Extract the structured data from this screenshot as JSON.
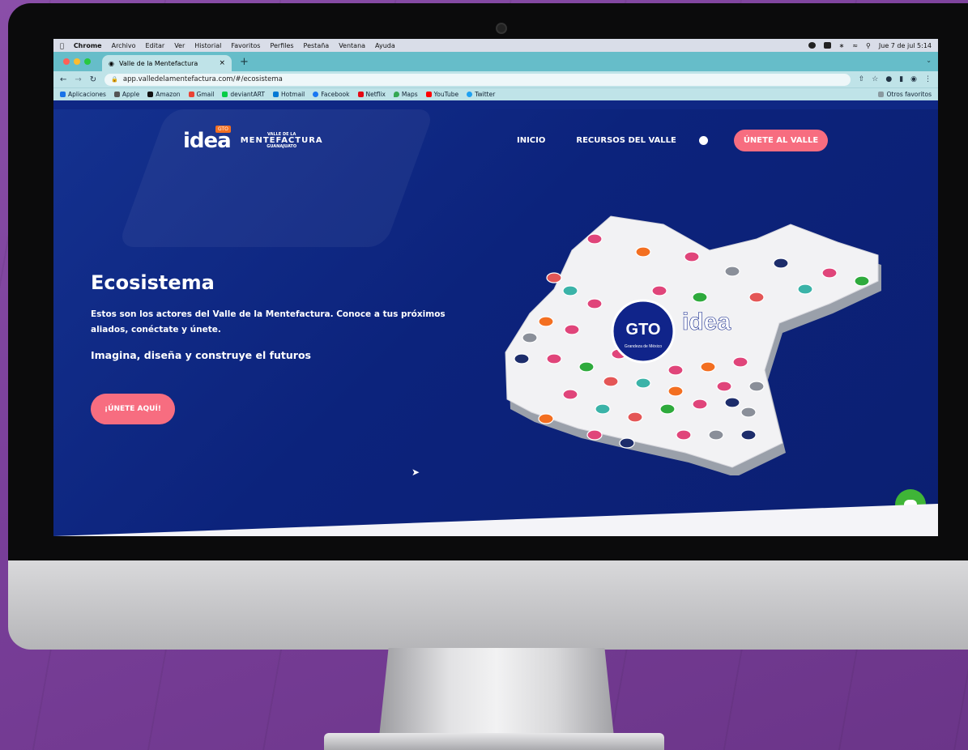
{
  "macos": {
    "menu": [
      "Chrome",
      "Archivo",
      "Editar",
      "Ver",
      "Historial",
      "Favoritos",
      "Perfiles",
      "Pestaña",
      "Ventana",
      "Ayuda"
    ],
    "clock": "Jue 7 de jul 5:14"
  },
  "browser": {
    "tab_title": "Valle de la Mentefactura",
    "url": "app.valledelamentefactura.com/#/ecosistema",
    "bookmarks": [
      "Aplicaciones",
      "Apple",
      "Amazon",
      "Gmail",
      "deviantART",
      "Hotmail",
      "Facebook",
      "Netflix",
      "Maps",
      "YouTube",
      "Twitter"
    ],
    "other_bookmarks": "Otros favoritos"
  },
  "site": {
    "logo": {
      "idea": "idea",
      "badge": "GTO",
      "top": "VALLE DE LA",
      "name": "MENTEFACTURA",
      "sub": "GUANAJUATO"
    },
    "nav": {
      "home": "INICIO",
      "resources": "RECURSOS DEL VALLE",
      "cta": "ÚNETE AL VALLE"
    },
    "hero": {
      "title": "Ecosistema",
      "description": "Estos son los actores del Valle de la Mentefactura. Conoce a tus próximos aliados, conéctate y únete.",
      "tagline": "Imagina, diseña y construye el futuros",
      "button": "¡ÚNETE AQUÍ!"
    },
    "map": {
      "gto_label": "GTO",
      "gto_sub": "Grandeza de México",
      "idea_label": "idea"
    },
    "colors": {
      "page": "#0f2784",
      "accent": "#f76d80",
      "chat": "#3fb537"
    }
  }
}
